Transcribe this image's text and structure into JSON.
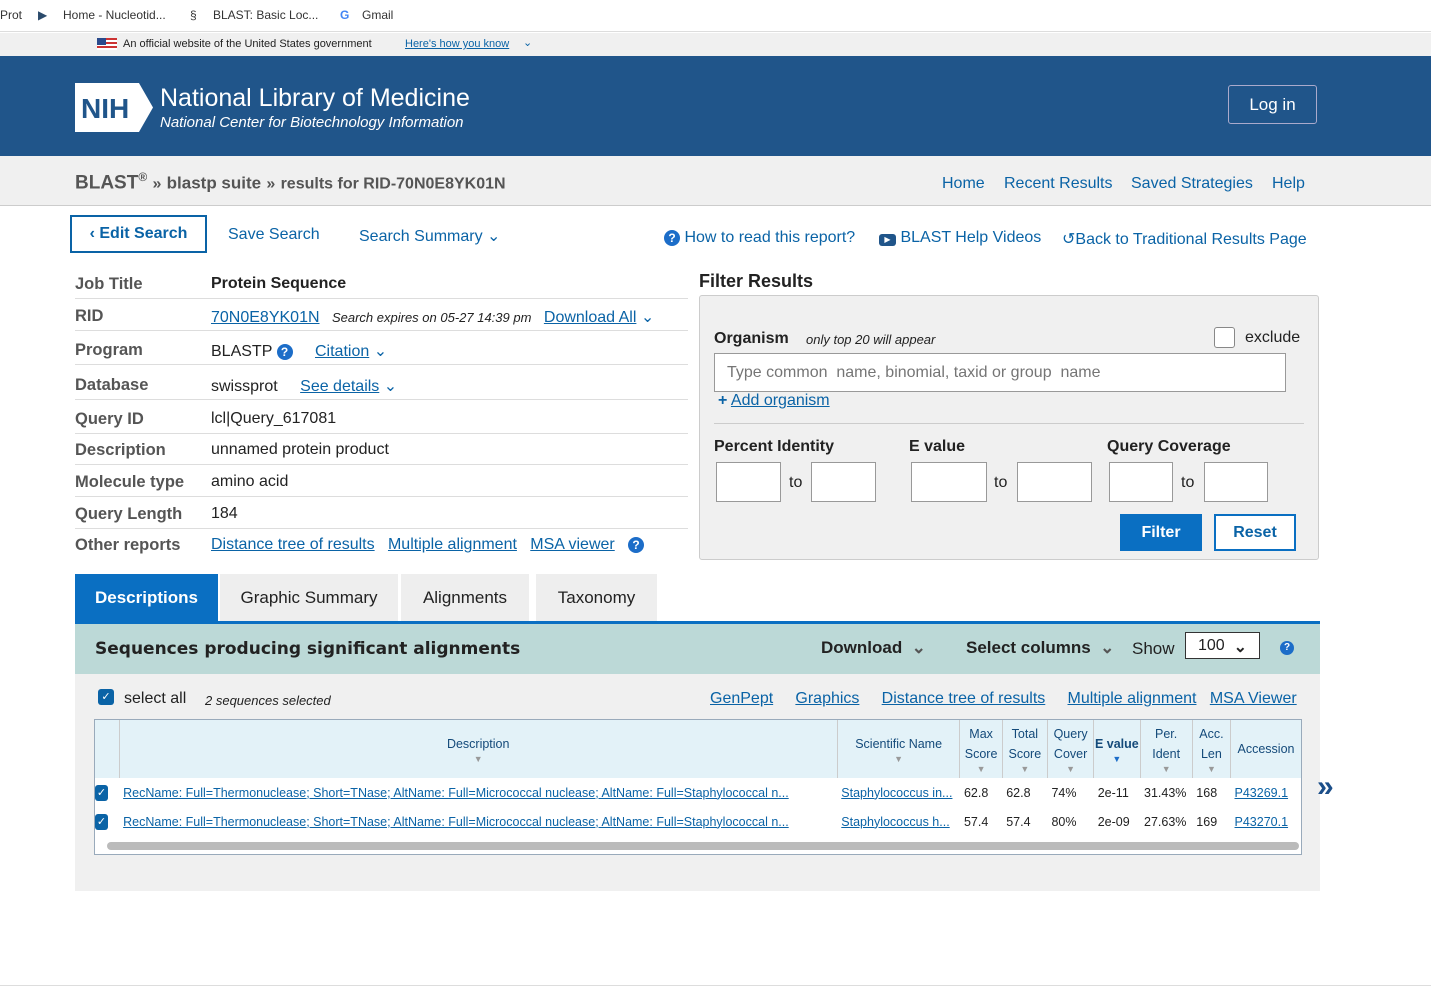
{
  "bookmarks": [
    "Prot",
    "Home - Nucleotid...",
    "BLAST: Basic Loc...",
    "Gmail"
  ],
  "gov": {
    "text": "An official website of the United States government",
    "link": "Here's how you know"
  },
  "header": {
    "logo": "NIH",
    "title": "National Library of Medicine",
    "subtitle": "National Center for Biotechnology Information",
    "login": "Log in"
  },
  "breadcrumb": {
    "blast": "BLAST",
    "reg": "®",
    "suite": "blastp suite",
    "results": "results for RID-70N0E8YK01N",
    "sep": "»"
  },
  "nav": [
    "Home",
    "Recent Results",
    "Saved Strategies",
    "Help"
  ],
  "toolbar": {
    "edit": "Edit Search",
    "save": "Save Search",
    "summary": "Search Summary",
    "howto": "How to read this report?",
    "videos": "BLAST Help Videos",
    "back": "Back to Traditional Results Page"
  },
  "info": {
    "job_title": {
      "k": "Job Title",
      "v": "Protein Sequence"
    },
    "rid": {
      "k": "RID",
      "v": "70N0E8YK01N",
      "expires": "Search expires on 05-27 14:39 pm",
      "download": "Download All"
    },
    "program": {
      "k": "Program",
      "v": "BLASTP",
      "citation": "Citation"
    },
    "database": {
      "k": "Database",
      "v": "swissprot",
      "details": "See details"
    },
    "query_id": {
      "k": "Query ID",
      "v": "lcl|Query_617081"
    },
    "description": {
      "k": "Description",
      "v": "unnamed protein product"
    },
    "molecule": {
      "k": "Molecule type",
      "v": "amino acid"
    },
    "length": {
      "k": "Query Length",
      "v": "184"
    },
    "other": {
      "k": "Other reports",
      "links": [
        "Distance tree of results",
        "Multiple alignment",
        "MSA viewer"
      ]
    }
  },
  "filter": {
    "title": "Filter Results",
    "organism": "Organism",
    "org_note": "only top 20 will appear",
    "exclude": "exclude",
    "placeholder": "Type common  name, binomial, taxid or group  name",
    "add": "Add organism",
    "pid": "Percent Identity",
    "evalue": "E value",
    "qcov": "Query Coverage",
    "to": "to",
    "filter": "Filter",
    "reset": "Reset"
  },
  "tabs": [
    "Descriptions",
    "Graphic Summary",
    "Alignments",
    "Taxonomy"
  ],
  "results": {
    "title": "Sequences producing significant alignments",
    "download": "Download",
    "select_columns": "Select columns",
    "show": "Show",
    "show_value": "100",
    "select_all": "select all",
    "selected": "2 sequences selected",
    "links": [
      "GenPept",
      "Graphics",
      "Distance tree of results",
      "Multiple alignment",
      "MSA Viewer"
    ],
    "columns": [
      "Description",
      "Scientific Name",
      "Max Score",
      "Total Score",
      "Query Cover",
      "E value",
      "Per. Ident",
      "Acc. Len",
      "Accession"
    ],
    "rows": [
      [
        "RecName: Full=Thermonuclease; Short=TNase; AltName: Full=Micrococcal nuclease; AltName: Full=Staphylococcal n...",
        "Staphylococcus in...",
        "62.8",
        "62.8",
        "74%",
        "2e-11",
        "31.43%",
        "168",
        "P43269.1"
      ],
      [
        "RecName: Full=Thermonuclease; Short=TNase; AltName: Full=Micrococcal nuclease; AltName: Full=Staphylococcal n...",
        "Staphylococcus h...",
        "57.4",
        "57.4",
        "80%",
        "2e-09",
        "27.63%",
        "169",
        "P43270.1"
      ]
    ]
  }
}
